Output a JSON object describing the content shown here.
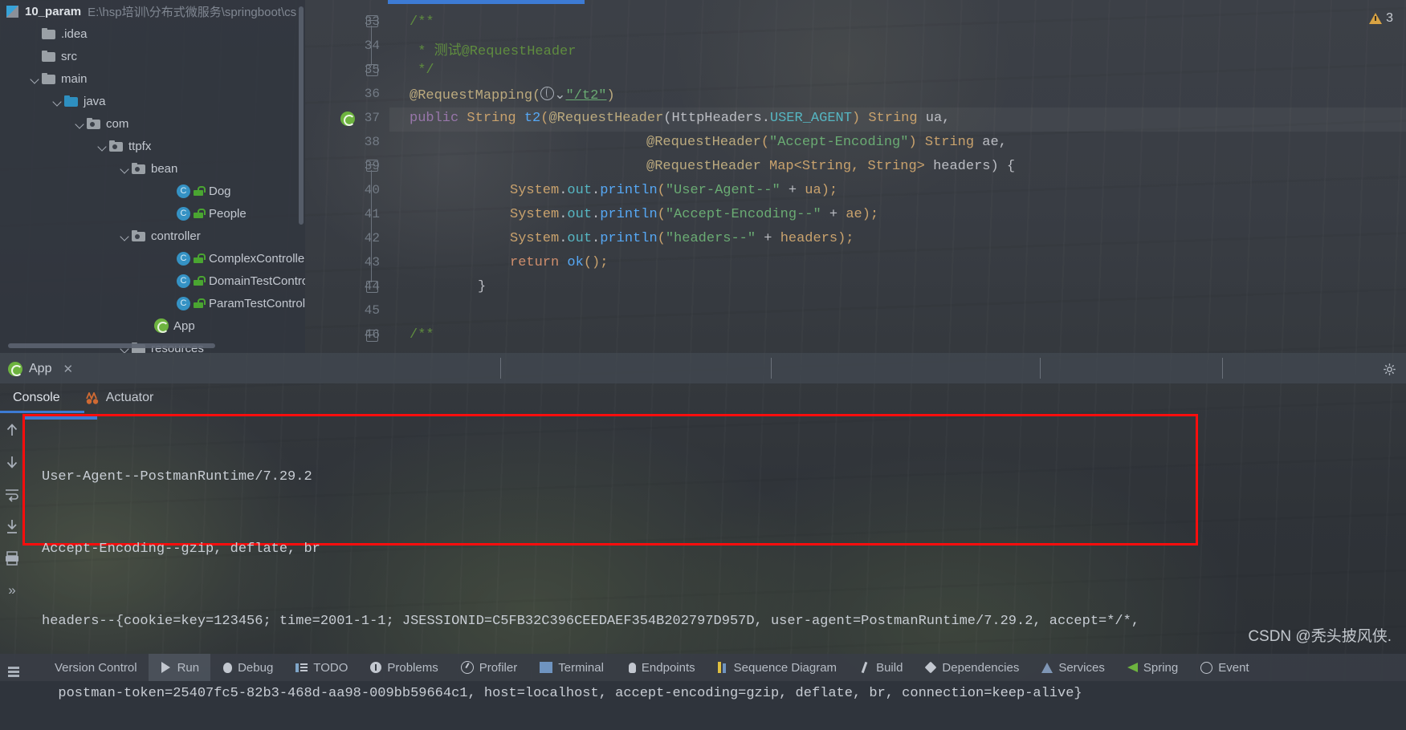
{
  "project": {
    "name": "10_param",
    "path": "E:\\hsp培训\\分布式微服务\\springboot\\cs",
    "tree": [
      {
        "label": ".idea",
        "type": "folder",
        "indent": 1,
        "arrow": "none"
      },
      {
        "label": "src",
        "type": "folder",
        "indent": 1,
        "arrow": "none"
      },
      {
        "label": "main",
        "type": "folder",
        "indent": 1,
        "arrow": "open"
      },
      {
        "label": "java",
        "type": "folder-source",
        "indent": 2,
        "arrow": "open"
      },
      {
        "label": "com",
        "type": "package",
        "indent": 3,
        "arrow": "open"
      },
      {
        "label": "ttpfx",
        "type": "package",
        "indent": 4,
        "arrow": "open"
      },
      {
        "label": "bean",
        "type": "package",
        "indent": 5,
        "arrow": "open"
      },
      {
        "label": "Dog",
        "type": "class",
        "indent": 7,
        "arrow": "none"
      },
      {
        "label": "People",
        "type": "class",
        "indent": 7,
        "arrow": "none"
      },
      {
        "label": "controller",
        "type": "package",
        "indent": 5,
        "arrow": "open"
      },
      {
        "label": "ComplexController",
        "type": "class",
        "indent": 7,
        "arrow": "none"
      },
      {
        "label": "DomainTestController",
        "type": "class",
        "indent": 7,
        "arrow": "none"
      },
      {
        "label": "ParamTestController",
        "type": "class",
        "indent": 7,
        "arrow": "none"
      },
      {
        "label": "App",
        "type": "spring-class",
        "indent": 6,
        "arrow": "none"
      },
      {
        "label": "resources",
        "type": "folder",
        "indent": 5,
        "arrow": "open"
      }
    ]
  },
  "editor": {
    "warning_count": "3",
    "lines": [
      {
        "num": "33",
        "text": "/**"
      },
      {
        "num": "34",
        "text": " * 测试@RequestHeader"
      },
      {
        "num": "35",
        "text": " */"
      },
      {
        "num": "36",
        "text": "@RequestMapping(\"/t2\")"
      },
      {
        "num": "37",
        "text": "public String t2(@RequestHeader(HttpHeaders.USER_AGENT) String ua,"
      },
      {
        "num": "38",
        "text": "                @RequestHeader(\"Accept-Encoding\") String ae,"
      },
      {
        "num": "39",
        "text": "                @RequestHeader Map<String, String> headers) {"
      },
      {
        "num": "40",
        "text": "    System.out.println(\"User-Agent--\" + ua);"
      },
      {
        "num": "41",
        "text": "    System.out.println(\"Accept-Encoding--\" + ae);"
      },
      {
        "num": "42",
        "text": "    System.out.println(\"headers--\" + headers);"
      },
      {
        "num": "43",
        "text": "    return ok();"
      },
      {
        "num": "44",
        "text": "}"
      },
      {
        "num": "45",
        "text": ""
      },
      {
        "num": "46",
        "text": "/**"
      }
    ],
    "tokens": {
      "mapping_url": "/t2",
      "public": "public",
      "string_type": "String",
      "method_name": "t2"
    }
  },
  "run_window": {
    "tab_label": "App",
    "close_label": "✕",
    "subtabs": [
      {
        "label": "Console",
        "active": true
      },
      {
        "label": "Actuator",
        "active": false
      }
    ],
    "console_lines": [
      "User-Agent--PostmanRuntime/7.29.2",
      "Accept-Encoding--gzip, deflate, br",
      "headers--{cookie=key=123456; time=2001-1-1; JSESSIONID=C5FB32C396CEEDAEF354B202797D957D, user-agent=PostmanRuntime/7.29.2, accept=*/*,",
      "  postman-token=25407fc5-82b3-468d-aa98-009bb59664c1, host=localhost, accept-encoding=gzip, deflate, br, connection=keep-alive}"
    ],
    "highlight_color": "#fd0d0d"
  },
  "status_bar": {
    "items": [
      {
        "label": "Version Control",
        "icon": "version-control-icon",
        "active": false
      },
      {
        "label": "Run",
        "icon": "run-icon",
        "active": true
      },
      {
        "label": "Debug",
        "icon": "debug-icon",
        "active": false
      },
      {
        "label": "TODO",
        "icon": "todo-icon",
        "active": false
      },
      {
        "label": "Problems",
        "icon": "problems-icon",
        "active": false
      },
      {
        "label": "Profiler",
        "icon": "profiler-icon",
        "active": false
      },
      {
        "label": "Terminal",
        "icon": "terminal-icon",
        "active": false
      },
      {
        "label": "Endpoints",
        "icon": "endpoints-icon",
        "active": false
      },
      {
        "label": "Sequence Diagram",
        "icon": "sequence-diagram-icon",
        "active": false
      },
      {
        "label": "Build",
        "icon": "build-icon",
        "active": false
      },
      {
        "label": "Dependencies",
        "icon": "dependencies-icon",
        "active": false
      },
      {
        "label": "Services",
        "icon": "services-icon",
        "active": false
      },
      {
        "label": "Spring",
        "icon": "spring-icon",
        "active": false
      },
      {
        "label": "Event",
        "icon": "event-icon",
        "active": false
      }
    ]
  },
  "watermark": "CSDN @秃头披风侠."
}
